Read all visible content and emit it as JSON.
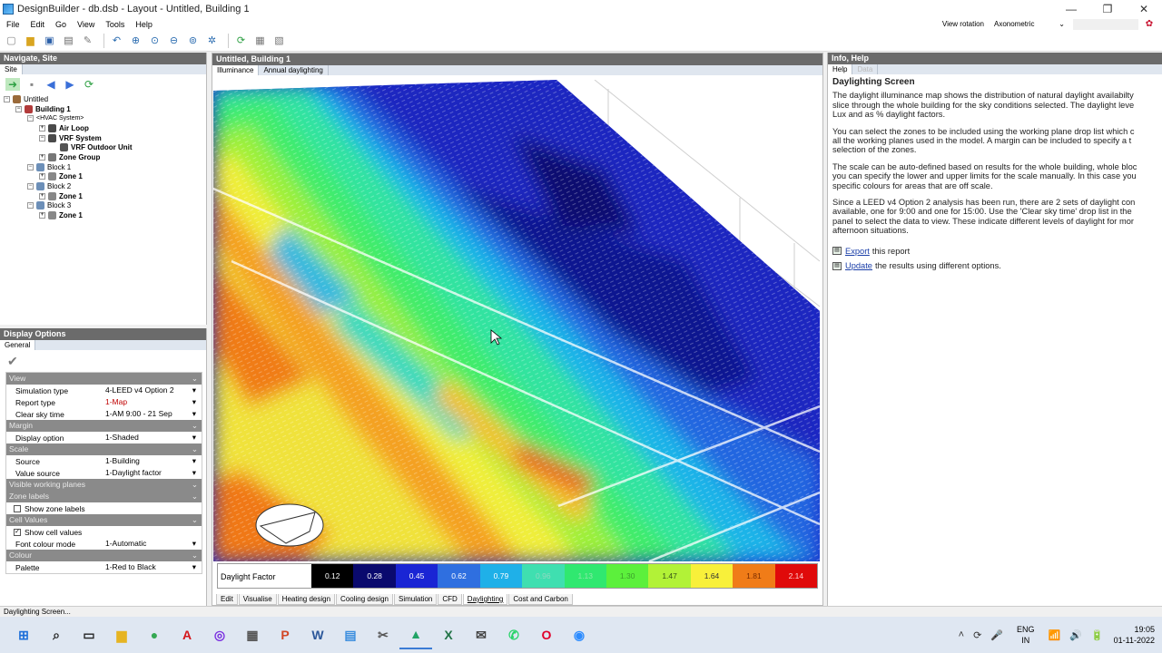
{
  "window": {
    "title": "DesignBuilder - db.dsb - Layout - Untitled, Building 1",
    "minimize": "—",
    "restore": "❐",
    "close": "✕"
  },
  "menu": [
    "File",
    "Edit",
    "Go",
    "View",
    "Tools",
    "Help"
  ],
  "view_rotation": {
    "label": "View rotation",
    "value": "Axonometric"
  },
  "navigate": {
    "header": "Navigate, Site",
    "tab": "Site",
    "tree": [
      {
        "label": "Untitled",
        "depth": 0,
        "bold": false,
        "exp": "−",
        "icon": "#9a6a3a"
      },
      {
        "label": "Building 1",
        "depth": 1,
        "bold": true,
        "exp": "−",
        "icon": "#b23b3b"
      },
      {
        "label": "<HVAC System>",
        "depth": 2,
        "bold": false,
        "exp": "−",
        "icon": "none"
      },
      {
        "label": "Air Loop",
        "depth": 3,
        "bold": true,
        "exp": "+",
        "icon": "#4a4a4a"
      },
      {
        "label": "VRF System",
        "depth": 3,
        "bold": true,
        "exp": "−",
        "icon": "#4a4a4a"
      },
      {
        "label": "VRF Outdoor Unit",
        "depth": 4,
        "bold": true,
        "exp": "",
        "icon": "#555"
      },
      {
        "label": "Zone Group",
        "depth": 3,
        "bold": true,
        "exp": "+",
        "icon": "#777"
      },
      {
        "label": "Block 1",
        "depth": 2,
        "bold": false,
        "exp": "−",
        "icon": "#6c8fb8"
      },
      {
        "label": "Zone 1",
        "depth": 3,
        "bold": true,
        "exp": "+",
        "icon": "#888"
      },
      {
        "label": "Block 2",
        "depth": 2,
        "bold": false,
        "exp": "−",
        "icon": "#6c8fb8"
      },
      {
        "label": "Zone 1",
        "depth": 3,
        "bold": true,
        "exp": "+",
        "icon": "#888"
      },
      {
        "label": "Block 3",
        "depth": 2,
        "bold": false,
        "exp": "−",
        "icon": "#6c8fb8"
      },
      {
        "label": "Zone 1",
        "depth": 3,
        "bold": true,
        "exp": "+",
        "icon": "#888"
      }
    ]
  },
  "display_options": {
    "header": "Display Options",
    "tab": "General",
    "apply_glyph": "✔",
    "sections": [
      {
        "title": "View",
        "rows": [
          {
            "key": "Simulation type",
            "value": "4-LEED v4 Option 2",
            "red": false
          },
          {
            "key": "Report type",
            "value": "1-Map",
            "red": true
          },
          {
            "key": "Clear sky time",
            "value": "1-AM 9:00 - 21 Sep",
            "red": false
          }
        ]
      },
      {
        "title": "Margin",
        "rows": [
          {
            "key": "Display option",
            "value": "1-Shaded",
            "red": false
          }
        ]
      },
      {
        "title": "Scale",
        "rows": [
          {
            "key": "Source",
            "value": "1-Building",
            "red": false
          },
          {
            "key": "Value source",
            "value": "1-Daylight factor",
            "red": false
          }
        ]
      },
      {
        "title": "Visible working planes",
        "rows": []
      },
      {
        "title": "Zone labels",
        "checks": [
          {
            "label": "Show zone labels",
            "checked": false
          }
        ]
      },
      {
        "title": "Cell Values",
        "checks": [
          {
            "label": "Show cell values",
            "checked": true
          }
        ],
        "rows": [
          {
            "key": "Font colour mode",
            "value": "1-Automatic",
            "red": false
          }
        ]
      },
      {
        "title": "Colour",
        "rows": [
          {
            "key": "Palette",
            "value": "1-Red to Black",
            "red": false
          }
        ]
      }
    ]
  },
  "center": {
    "header": "Untitled, Building 1",
    "tabs": [
      {
        "label": "Illuminance",
        "active": true
      },
      {
        "label": "Annual daylighting",
        "active": false
      }
    ],
    "legend": {
      "title": "Daylight Factor",
      "cells": [
        {
          "value": "0.12",
          "color": "#000000",
          "text": "#ffffff"
        },
        {
          "value": "0.28",
          "color": "#0a0a6e",
          "text": "#ffffff"
        },
        {
          "value": "0.45",
          "color": "#1a25d4",
          "text": "#ffffff"
        },
        {
          "value": "0.62",
          "color": "#2f6fe0",
          "text": "#ffffff"
        },
        {
          "value": "0.79",
          "color": "#1fb0e8",
          "text": "#ffffff"
        },
        {
          "value": "0.96",
          "color": "#3fdfb0",
          "text": "#8fd9c0"
        },
        {
          "value": "1.13",
          "color": "#30e870",
          "text": "#8be8a8"
        },
        {
          "value": "1.30",
          "color": "#5cf03c",
          "text": "#3c9e2c"
        },
        {
          "value": "1.47",
          "color": "#b2f237",
          "text": "#365218"
        },
        {
          "value": "1.64",
          "color": "#f8f03a",
          "text": "#333333"
        },
        {
          "value": "1.81",
          "color": "#f07c18",
          "text": "#7a2c00"
        },
        {
          "value": "2.14",
          "color": "#e00a0a",
          "text": "#ffd0d0"
        }
      ]
    },
    "bottom_tabs": [
      {
        "label": "Edit",
        "active": false
      },
      {
        "label": "Visualise",
        "active": false
      },
      {
        "label": "Heating design",
        "active": false
      },
      {
        "label": "Cooling design",
        "active": false
      },
      {
        "label": "Simulation",
        "active": false
      },
      {
        "label": "CFD",
        "active": false
      },
      {
        "label": "Daylighting",
        "active": true
      },
      {
        "label": "Cost and Carbon",
        "active": false
      }
    ]
  },
  "info": {
    "header": "Info, Help",
    "tabs": [
      {
        "label": "Help",
        "active": true,
        "dim": false
      },
      {
        "label": "Data",
        "active": false,
        "dim": true
      }
    ],
    "title": "Daylighting Screen",
    "paragraphs": [
      [
        "The daylight illuminance map shows the distribution of natural daylight availabilty",
        "slice through the whole building for the sky conditions selected. The daylight leve",
        "Lux and as % daylight factors."
      ],
      [
        "You can select the zones to be included using the working plane drop list which c",
        "all the working planes used in the model. A margin can be included to specify a t",
        "selection of the zones."
      ],
      [
        "The scale can be auto-defined based on results for the whole building, whole bloc",
        "you can specify the lower and upper limits for the scale manually. In this case you",
        "specific colours for areas that are off scale."
      ],
      [
        "Since a LEED v4 Option 2 analysis has been run, there are 2 sets of daylight con",
        "available, one for 9:00 and one for 15:00. Use the 'Clear sky time' drop list in the",
        "panel to select the data to view. These indicate different levels of daylight for mor",
        "afternoon situations."
      ]
    ],
    "links": [
      {
        "link": "Export",
        "rest": "this report"
      },
      {
        "link": "Update",
        "rest": "the results using different options."
      }
    ]
  },
  "status": "Daylighting Screen...",
  "taskbar": {
    "apps": [
      {
        "name": "start",
        "glyph": "⊞",
        "color": "#1e6fd9"
      },
      {
        "name": "search",
        "glyph": "⌕",
        "color": "#222"
      },
      {
        "name": "task-view",
        "glyph": "▭",
        "color": "#222"
      },
      {
        "name": "file-explorer",
        "glyph": "▆",
        "color": "#e6b422"
      },
      {
        "name": "chrome",
        "glyph": "●",
        "color": "#34a853"
      },
      {
        "name": "acrobat",
        "glyph": "A",
        "color": "#d4161b"
      },
      {
        "name": "app-purple",
        "glyph": "◎",
        "color": "#7a2ee0"
      },
      {
        "name": "calculator",
        "glyph": "▦",
        "color": "#555"
      },
      {
        "name": "powerpoint",
        "glyph": "P",
        "color": "#d24726"
      },
      {
        "name": "word",
        "glyph": "W",
        "color": "#2b579a"
      },
      {
        "name": "notepad",
        "glyph": "▤",
        "color": "#3a8dde"
      },
      {
        "name": "snipping-tool",
        "glyph": "✂",
        "color": "#555"
      },
      {
        "name": "designbuilder",
        "glyph": "▲",
        "color": "#21a366"
      },
      {
        "name": "excel",
        "glyph": "X",
        "color": "#217346"
      },
      {
        "name": "mail",
        "glyph": "✉",
        "color": "#444"
      },
      {
        "name": "whatsapp",
        "glyph": "✆",
        "color": "#25d366"
      },
      {
        "name": "opera",
        "glyph": "O",
        "color": "#e0002b"
      },
      {
        "name": "zoom",
        "glyph": "◉",
        "color": "#2d8cff"
      }
    ],
    "tray": [
      "˄",
      "⟳",
      "🎤"
    ],
    "lang": [
      "ENG",
      "IN"
    ],
    "tray2": [
      "📶",
      "🔊",
      "🔋"
    ],
    "time": "19:05",
    "date": "01-11-2022"
  }
}
